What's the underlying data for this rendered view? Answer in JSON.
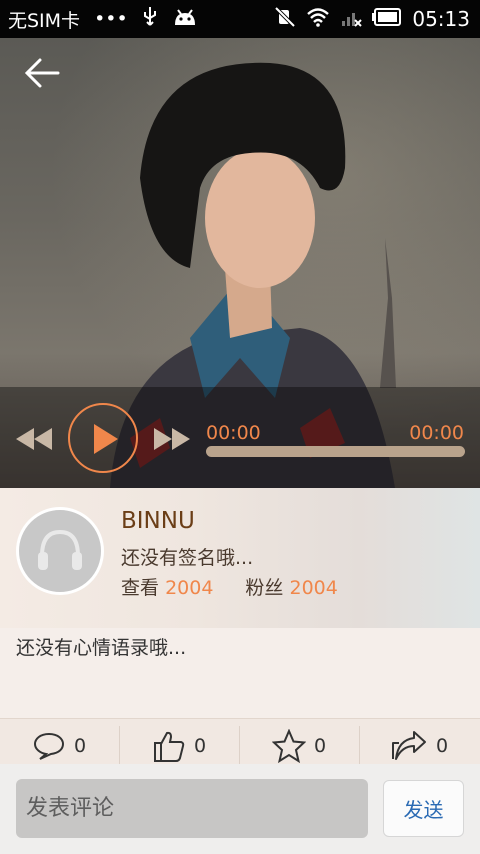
{
  "status_bar": {
    "carrier": "无SIM卡",
    "dots": "•••",
    "time": "05:13",
    "icons": [
      "usb-icon",
      "android-icon",
      "mute-icon",
      "wifi-icon",
      "signal-icon",
      "battery-icon"
    ]
  },
  "player": {
    "current_time": "00:00",
    "total_time": "00:00",
    "progress": 0,
    "accent": "#f0874b"
  },
  "profile": {
    "username": "BINNU",
    "signature": "还没有签名哦...",
    "views_label": "查看",
    "views": "2004",
    "fans_label": "粉丝",
    "fans": "2004"
  },
  "mood": {
    "text": "还没有心情语录哦..."
  },
  "actions": {
    "comment_count": "0",
    "like_count": "0",
    "favorite_count": "0",
    "share_count": "0"
  },
  "comment": {
    "placeholder": "发表评论",
    "send_label": "发送"
  }
}
